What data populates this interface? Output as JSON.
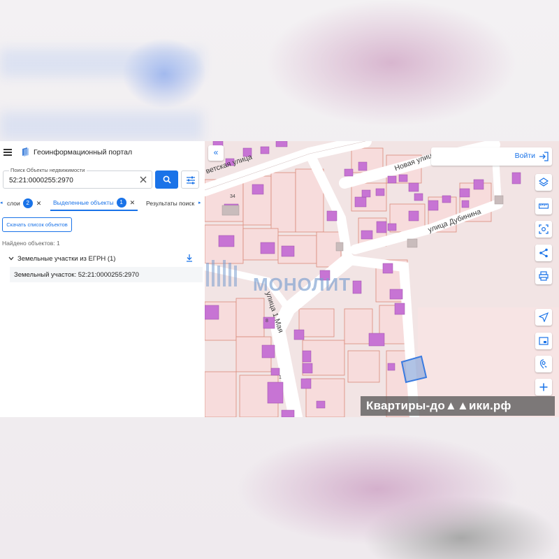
{
  "app": {
    "title": "Геоинформационный портал"
  },
  "search": {
    "label": "Поиск Объекты недвижимости",
    "value": "52:21:0000255:2970"
  },
  "tabs": [
    {
      "label": "слои",
      "badge": "2"
    },
    {
      "label": "Выделенные объекты",
      "badge": "1",
      "active": true
    },
    {
      "label": "Результаты поиск"
    }
  ],
  "results": {
    "download_button": "Скачать список объектов",
    "found": "Найдено объектов: 1",
    "group_title": "Земельные участки из ЕГРН (1)",
    "item": "Земельный участок: 52:21:0000255:2970"
  },
  "map": {
    "streets": {
      "sovetskaya": "ветская улица",
      "novaya": "Новая улица",
      "dubinina": "улица Дубинина",
      "first_may": "улица 1 Мая"
    },
    "house_numbers": [
      "34",
      "8",
      "1"
    ],
    "login": "Войти",
    "tools": [
      "layers-icon",
      "ruler-icon",
      "area-select-icon",
      "share-icon",
      "print-icon",
      "navigate-icon",
      "minimap-icon",
      "locate-icon",
      "zoom-in-icon"
    ]
  },
  "overlay": {
    "watermark": "МОНОЛИТ",
    "brand": "Квартиры-до▲▲ики.рф"
  },
  "colors": {
    "accent": "#1a73e8",
    "building": "#c774d4",
    "parcel_border": "#d98a7a",
    "selected_parcel": "#5b8fe0"
  }
}
